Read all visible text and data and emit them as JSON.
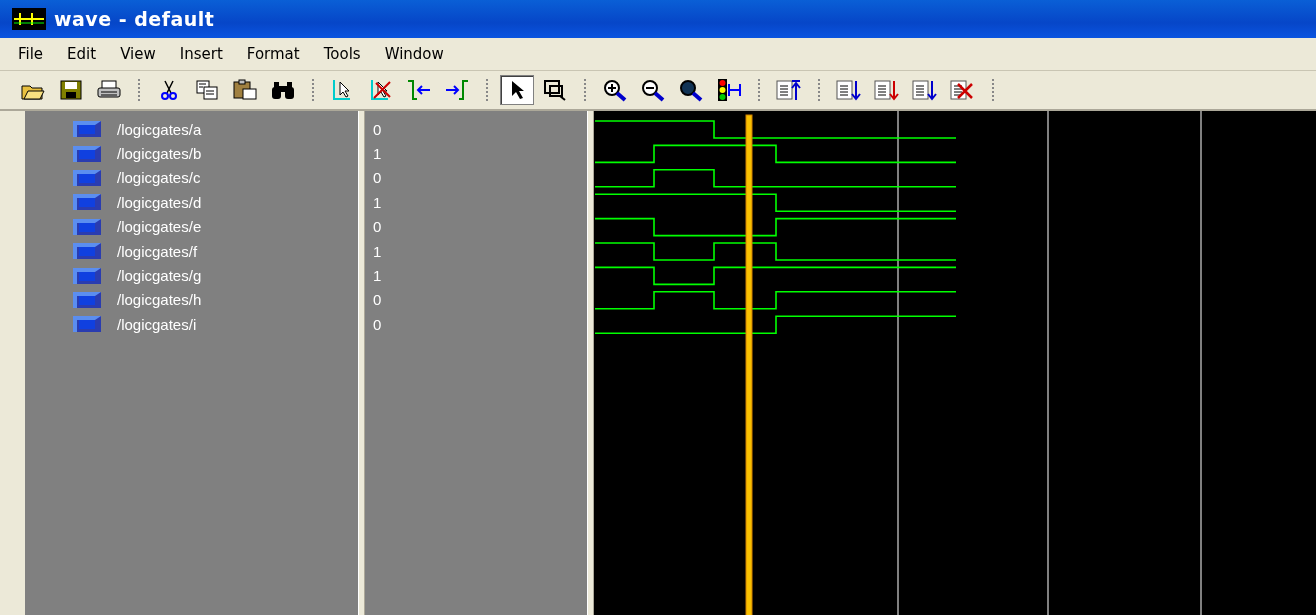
{
  "window": {
    "title": "wave - default"
  },
  "menu": [
    "File",
    "Edit",
    "View",
    "Insert",
    "Format",
    "Tools",
    "Window"
  ],
  "toolbar": [
    [
      {
        "kind": "open",
        "selected": false
      },
      {
        "kind": "save",
        "selected": false
      },
      {
        "kind": "print",
        "selected": false
      }
    ],
    [
      {
        "kind": "cut",
        "selected": false
      },
      {
        "kind": "copy",
        "selected": false
      },
      {
        "kind": "paste",
        "selected": false
      },
      {
        "kind": "find",
        "selected": false
      }
    ],
    [
      {
        "kind": "cursor-add",
        "selected": false
      },
      {
        "kind": "cursor-delete",
        "selected": false
      },
      {
        "kind": "edge-prev",
        "selected": false
      },
      {
        "kind": "edge-next",
        "selected": false
      }
    ],
    [
      {
        "kind": "pointer",
        "selected": true
      },
      {
        "kind": "zoom-mode",
        "selected": false
      }
    ],
    [
      {
        "kind": "zoom-in",
        "selected": false
      },
      {
        "kind": "zoom-out",
        "selected": false
      },
      {
        "kind": "zoom-full",
        "selected": false
      },
      {
        "kind": "traffic",
        "selected": false
      }
    ],
    [
      {
        "kind": "list-up",
        "selected": false
      }
    ],
    [
      {
        "kind": "list-down",
        "selected": false
      },
      {
        "kind": "list-updown",
        "selected": false
      },
      {
        "kind": "list-down2",
        "selected": false
      },
      {
        "kind": "list-delete",
        "selected": false
      }
    ]
  ],
  "signals": [
    {
      "name": "/logicgates/a",
      "value": "0"
    },
    {
      "name": "/logicgates/b",
      "value": "1"
    },
    {
      "name": "/logicgates/c",
      "value": "0"
    },
    {
      "name": "/logicgates/d",
      "value": "1"
    },
    {
      "name": "/logicgates/e",
      "value": "0"
    },
    {
      "name": "/logicgates/f",
      "value": "1"
    },
    {
      "name": "/logicgates/g",
      "value": "1"
    },
    {
      "name": "/logicgates/h",
      "value": "0"
    },
    {
      "name": "/logicgates/i",
      "value": "0"
    }
  ]
}
